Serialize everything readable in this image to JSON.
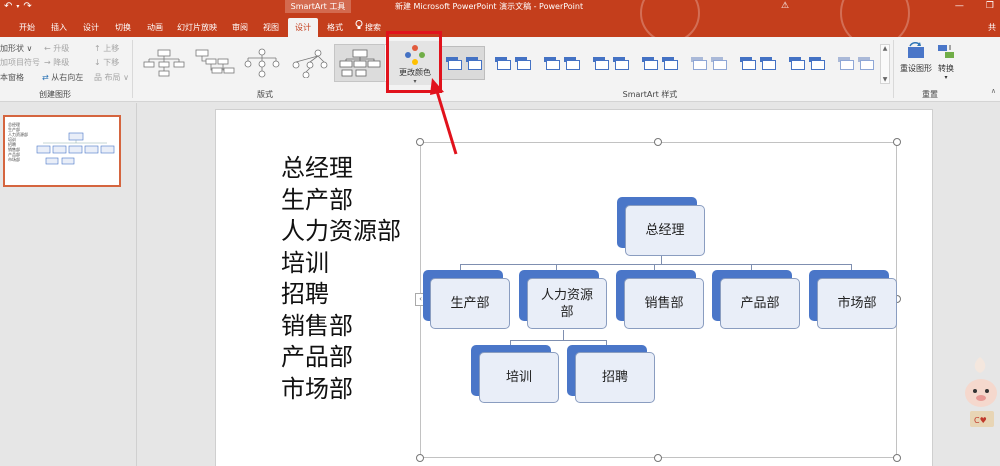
{
  "title_bar": {
    "contextual_tab": "SmartArt 工具",
    "document_title": "新建 Microsoft PowerPoint 演示文稿 - PowerPoint",
    "warning_glyph": "⚠",
    "window_buttons": [
      "—",
      "❐"
    ]
  },
  "tabs": [
    "开始",
    "插入",
    "设计",
    "切换",
    "动画",
    "幻灯片放映",
    "审阅",
    "视图",
    "设计",
    "格式"
  ],
  "active_tab_index": 8,
  "search_label": "搜索",
  "ribbon": {
    "create_graphic": {
      "items": [
        "加形状 ∨",
        "加项目符号",
        "本窗格",
        "升级",
        "降级",
        "从右向左",
        "上移",
        "下移",
        "布局 ∨"
      ],
      "label": "创建图形"
    },
    "layouts_label": "版式",
    "change_colors_label": "更改颜色",
    "styles_label": "SmartArt 样式",
    "reset": {
      "reset_graphic": "重设图形",
      "convert": "转换",
      "label": "重置"
    },
    "share_partial": "共"
  },
  "colors": {
    "brand": "#c43e1c",
    "highlight": "#e1121c",
    "node_accent": "#4a76c8",
    "node_fill": "#e9eef8"
  },
  "slide_panel": {
    "slide_number": "1"
  },
  "slide": {
    "text_pane_lines": [
      "总经理",
      "生产部",
      "人力资源部",
      "培训",
      "招聘",
      "销售部",
      "产品部",
      "市场部"
    ],
    "org_chart": {
      "top": "总经理",
      "level2": [
        "生产部",
        "人力资源部",
        "销售部",
        "产品部",
        "市场部"
      ],
      "level3": [
        "培训",
        "招聘"
      ]
    }
  }
}
